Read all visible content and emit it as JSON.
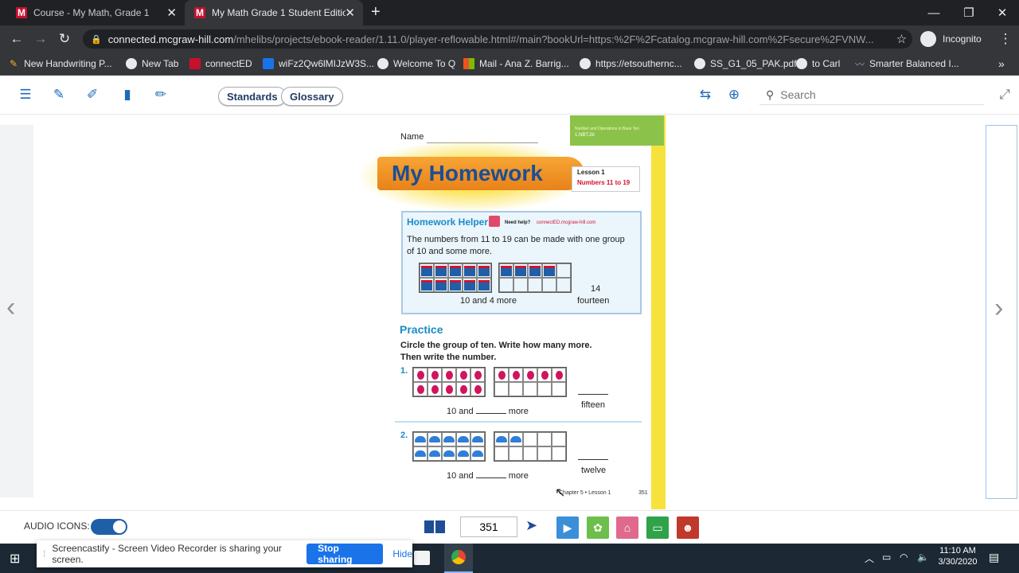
{
  "browser": {
    "tabs": [
      {
        "title": "Course - My Math, Grade 1",
        "favicon": "M"
      },
      {
        "title": "My Math Grade 1 Student Edition",
        "favicon": "M"
      }
    ],
    "new_tab_symbol": "+",
    "url_host": "connected.mcgraw-hill.com",
    "url_path": "/mhelibs/projects/ebook-reader/1.11.0/player-reflowable.html#/main?bookUrl=https:%2F%2Fcatalog.mcgraw-hill.com%2Fsecure%2FVNW...",
    "profile_label": "Incognito",
    "bookmarks": [
      "New Handwriting P...",
      "New Tab",
      "connectED",
      "wiFz2Qw6lMIJzW3S...",
      "Welcome To Q",
      "Mail - Ana Z. Barrig...",
      "https://etsouthernc...",
      "SS_G1_05_PAK.pdf",
      "to Carl",
      "Smarter Balanced I..."
    ],
    "more_bookmarks": "»"
  },
  "reader": {
    "standards_label": "Standards",
    "glossary_label": "Glossary",
    "search_placeholder": "Search",
    "audio_icons_label": "AUDIO ICONS:",
    "audio_icons_on": true,
    "page_number": "351"
  },
  "page": {
    "name_label": "Name",
    "standard_tag": "Number and Operations in Base Ten",
    "standard_code": "1.NBT.2b",
    "banner_title": "My Homework",
    "lesson_label": "Lesson 1",
    "lesson_title": "Numbers 11 to 19",
    "helper_title": "Homework Helper",
    "need_help": "Need help?",
    "help_link": "connectED.mcgraw-hill.com",
    "helper_text": "The numbers from 11 to 19 can be made with one group of 10 and some more.",
    "example_caption": "10 and 4 more",
    "example_number": "14",
    "example_word": "fourteen",
    "practice_title": "Practice",
    "instructions_1": "Circle the group of ten. Write how many more.",
    "instructions_2": "Then write the number.",
    "problems": [
      {
        "num": "1.",
        "prefix": "10 and",
        "suffix": "more",
        "word": "fifteen"
      },
      {
        "num": "2.",
        "prefix": "10 and",
        "suffix": "more",
        "word": "twelve"
      }
    ],
    "footer": "Chapter 5 • Lesson 1",
    "page_num": "351"
  },
  "notification": {
    "text": "Screencastify - Screen Video Recorder is sharing your screen.",
    "stop_label": "Stop sharing",
    "hide_label": "Hide"
  },
  "taskbar": {
    "time": "11:10 AM",
    "date": "3/30/2020"
  }
}
